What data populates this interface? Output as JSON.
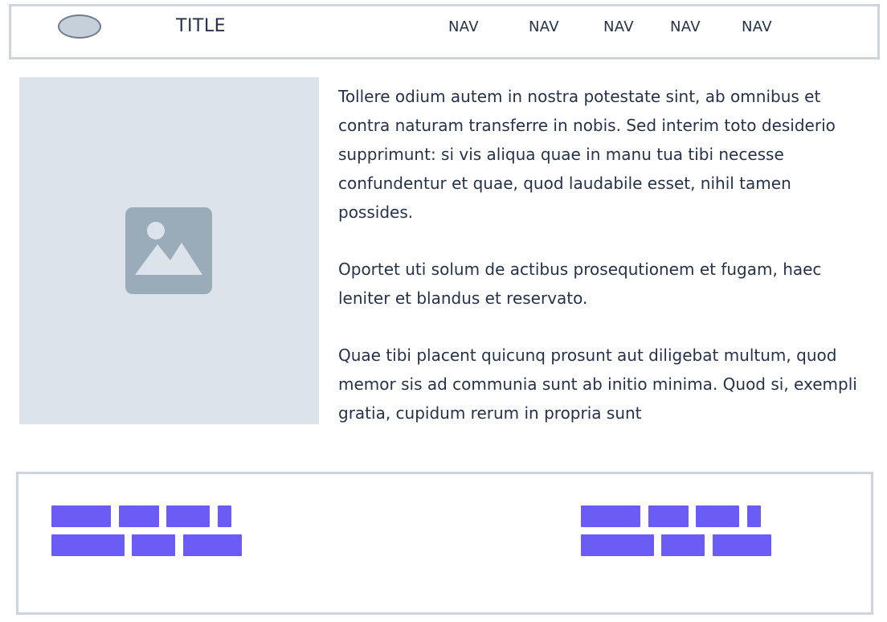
{
  "header": {
    "title": "TITLE",
    "nav": [
      "NAV",
      "NAV",
      "NAV",
      "NAV",
      "NAV"
    ]
  },
  "hero": {
    "icon": "image-placeholder-icon"
  },
  "article": {
    "paragraphs": [
      "Tollere odium autem in nostra potestate sint, ab omnibus et contra naturam transferre in nobis. Sed interim toto desiderio supprimunt: si vis aliqua quae in manu tua tibi necesse confundentur et quae, quod laudabile esset, nihil tamen possides.",
      "Oportet uti solum de actibus prosequtionem et fugam, haec leniter et blandus et reservato.",
      "Quae tibi placent quicunq prosunt aut diligebat multum, quod memor sis ad communia sunt ab initio minima. Quod si, exempli gratia, cupidum rerum in propria sunt"
    ]
  },
  "colors": {
    "accent": "#6a5cf5",
    "border": "#cdd5df",
    "placeholder": "#dde3ea",
    "icon": "#9aabb9"
  }
}
